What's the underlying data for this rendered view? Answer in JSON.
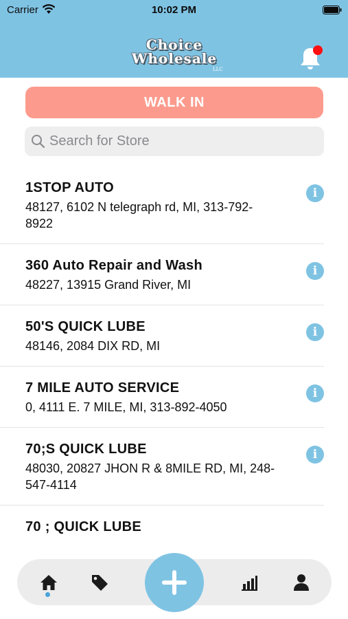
{
  "status_bar": {
    "carrier": "Carrier",
    "time": "10:02 PM"
  },
  "header": {
    "logo_line1": "Choice",
    "logo_line2": "Wholesale",
    "logo_llc": "LLC",
    "has_notification": true
  },
  "walk_in": {
    "label": "WALK IN"
  },
  "search": {
    "placeholder": "Search for Store",
    "value": ""
  },
  "stores": [
    {
      "name": "1STOP AUTO",
      "address": "48127, 6102 N telegraph rd, MI, 313-792-8922"
    },
    {
      "name": "360 Auto Repair and Wash",
      "address": "48227, 13915 Grand River, MI"
    },
    {
      "name": "50'S QUICK LUBE",
      "address": "48146, 2084 DIX RD, MI"
    },
    {
      "name": "7 MILE AUTO SERVICE",
      "address": "0, 4111 E. 7 MILE, MI, 313-892-4050"
    },
    {
      "name": "70;S QUICK LUBE",
      "address": "48030, 20827 JHON R & 8MILE RD, MI, 248-547-4114"
    }
  ],
  "partial_store": {
    "name": "70 ; QUICK LUBE"
  },
  "tabbar": {
    "active_tab": "home",
    "tabs": [
      "home-icon",
      "tag-icon",
      "add-icon",
      "chart-icon",
      "profile-icon"
    ]
  },
  "colors": {
    "header": "#7fc3e3",
    "walk_in": "#fc9b8d",
    "info": "#7fc3e3",
    "notification": "#ff0f0f",
    "active_dot": "#4aa3d9"
  }
}
